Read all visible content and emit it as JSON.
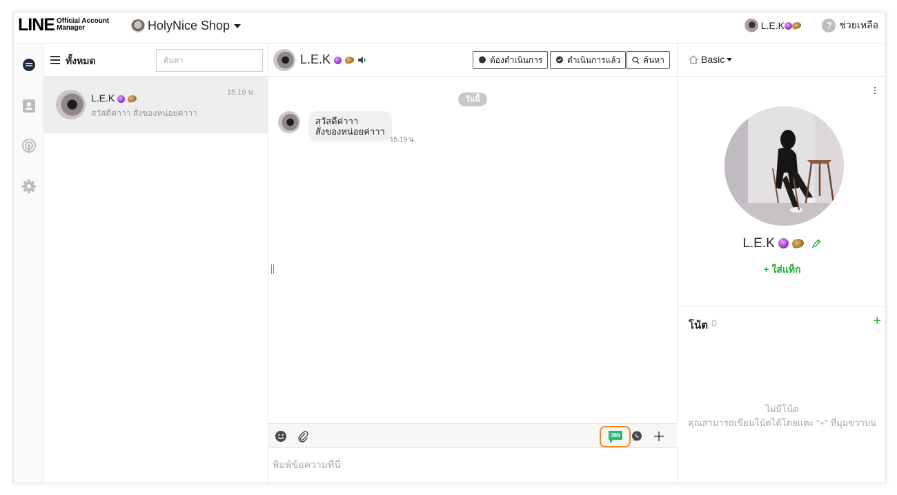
{
  "header": {
    "logo_main": "LINE",
    "logo_sub_line1": "Official Account",
    "logo_sub_line2": "Manager",
    "shop_name": "HolyNice Shop",
    "account_name": "L.E.K",
    "help_label": "ช่วยเหลือ",
    "help_icon_text": "?"
  },
  "rail": {
    "items": [
      "chat-icon",
      "contacts-icon",
      "broadcast-icon",
      "settings-icon"
    ],
    "active_color": "#1e2b3c",
    "inactive_color": "#bbbbbb"
  },
  "chat_list": {
    "filter_label": "ทั้งหมด",
    "search_placeholder": "ค้นหา",
    "rows": [
      {
        "name": "L.E.K",
        "preview": "สวัสดีค่าาา สั่งของหน่อยค่าาา",
        "time": "15.19 น."
      }
    ]
  },
  "chat": {
    "contact_name": "L.E.K",
    "buttons": {
      "todo": "ต้องดำเนินการ",
      "done": "ดำเนินการแล้ว",
      "search": "ค้นหา"
    },
    "date_label": "วันนี้",
    "messages": [
      {
        "line1": "สวัสดีค่าาา",
        "line2": "สั่งของหน่อยค่าาา",
        "time": "15.19 น."
      }
    ],
    "composer_placeholder": "พิมพ์ข้อความที่นี่",
    "toolbar": {
      "badge_365": "365"
    }
  },
  "profile": {
    "plan": "Basic",
    "name": "L.E.K",
    "add_tag": "+ ใส่แท็ก",
    "notes_label": "โน้ต",
    "notes_count": "0",
    "notes_add": "+",
    "notes_empty_line1": "ไม่มีโน้ต",
    "notes_empty_line2": "คุณสามารถเขียนโน้ตได้โดยแตะ \"+\" ที่มุมขวาบน"
  },
  "colors": {
    "accent_green": "#19b23b",
    "highlight_orange": "#f08a1c",
    "selected_row": "#eeeeee"
  }
}
